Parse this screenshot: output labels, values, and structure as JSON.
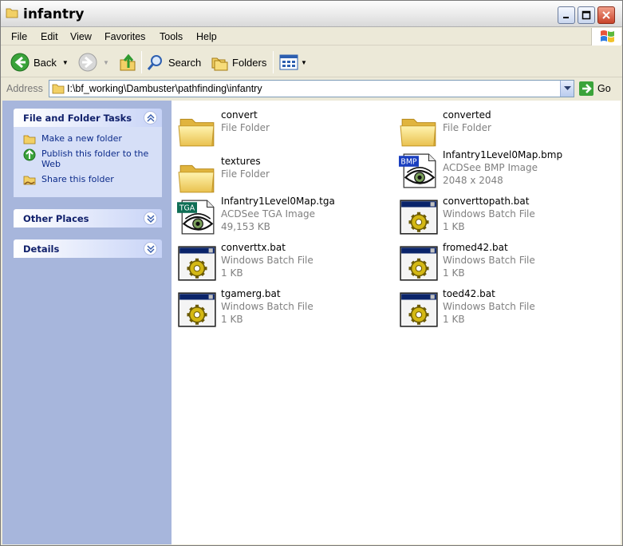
{
  "window": {
    "title": "infantry"
  },
  "menu": [
    "File",
    "Edit",
    "View",
    "Favorites",
    "Tools",
    "Help"
  ],
  "toolbar": {
    "back": "Back",
    "search": "Search",
    "folders": "Folders"
  },
  "address": {
    "label": "Address",
    "path": "I:\\bf_working\\Dambuster\\pathfinding\\infantry",
    "go": "Go"
  },
  "tasks": {
    "file_folder": {
      "title": "File and Folder Tasks",
      "items": [
        "Make a new folder",
        "Publish this folder to the Web",
        "Share this folder"
      ]
    },
    "other_places": {
      "title": "Other Places"
    },
    "details": {
      "title": "Details"
    }
  },
  "files": [
    {
      "name": "convert",
      "type": "File Folder",
      "size": "",
      "icon": "folder-icon"
    },
    {
      "name": "converted",
      "type": "File Folder",
      "size": "",
      "icon": "folder-icon"
    },
    {
      "name": "textures",
      "type": "File Folder",
      "size": "",
      "icon": "folder-icon"
    },
    {
      "name": "Infantry1Level0Map.bmp",
      "type": "ACDSee BMP Image",
      "size": "2048 x 2048",
      "icon": "bmp-image-icon"
    },
    {
      "name": "Infantry1Level0Map.tga",
      "type": "ACDSee TGA Image",
      "size": "49,153 KB",
      "icon": "tga-image-icon"
    },
    {
      "name": "converttopath.bat",
      "type": "Windows Batch File",
      "size": "1 KB",
      "icon": "batch-file-icon"
    },
    {
      "name": "converttx.bat",
      "type": "Windows Batch File",
      "size": "1 KB",
      "icon": "batch-file-icon"
    },
    {
      "name": "fromed42.bat",
      "type": "Windows Batch File",
      "size": "1 KB",
      "icon": "batch-file-icon"
    },
    {
      "name": "tgamerg.bat",
      "type": "Windows Batch File",
      "size": "1 KB",
      "icon": "batch-file-icon"
    },
    {
      "name": "toed42.bat",
      "type": "Windows Batch File",
      "size": "1 KB",
      "icon": "batch-file-icon"
    }
  ]
}
